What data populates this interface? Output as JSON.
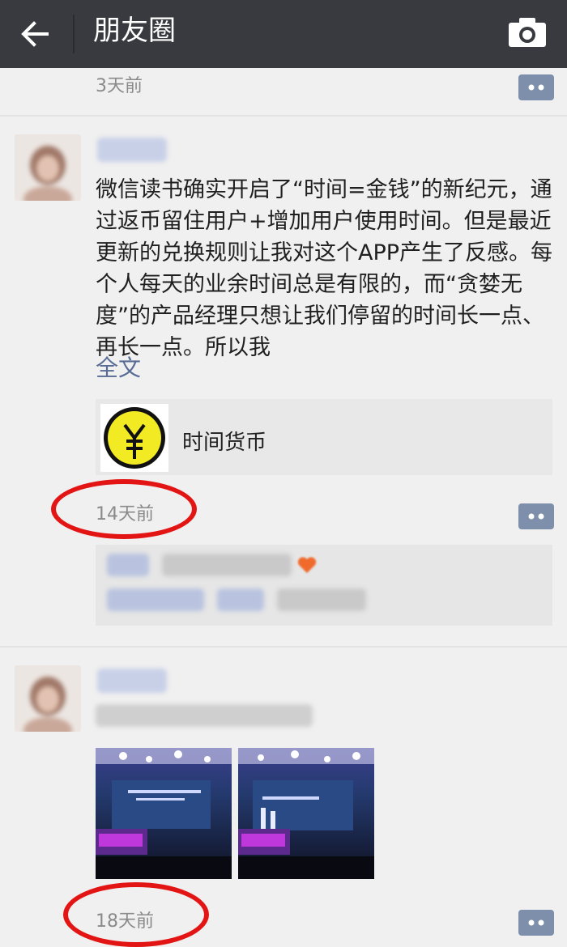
{
  "header": {
    "title": "朋友圈",
    "back_icon": "arrow-left-icon",
    "camera_icon": "camera-icon"
  },
  "top_post": {
    "time": "3天前"
  },
  "post1": {
    "text": "微信读书确实开启了“时间=金钱”的新纪元，通过返币留住用户+增加用户使用时间。但是最近更新的兑换规则让我对这个APP产生了反感。每个人每天的业余时间总是有限的，而“贪婪无度”的产品经理只想让我们停留的时间长一点、再长一点。所以我",
    "full_text_label": "全文",
    "link_card": {
      "title": "时间货币",
      "logo_icon": "yen-coin-icon"
    },
    "time": "14天前"
  },
  "post2": {
    "time": "18天前"
  },
  "colors": {
    "topbar": "#393a3f",
    "link": "#576b95",
    "annotation_red": "#e31414"
  }
}
